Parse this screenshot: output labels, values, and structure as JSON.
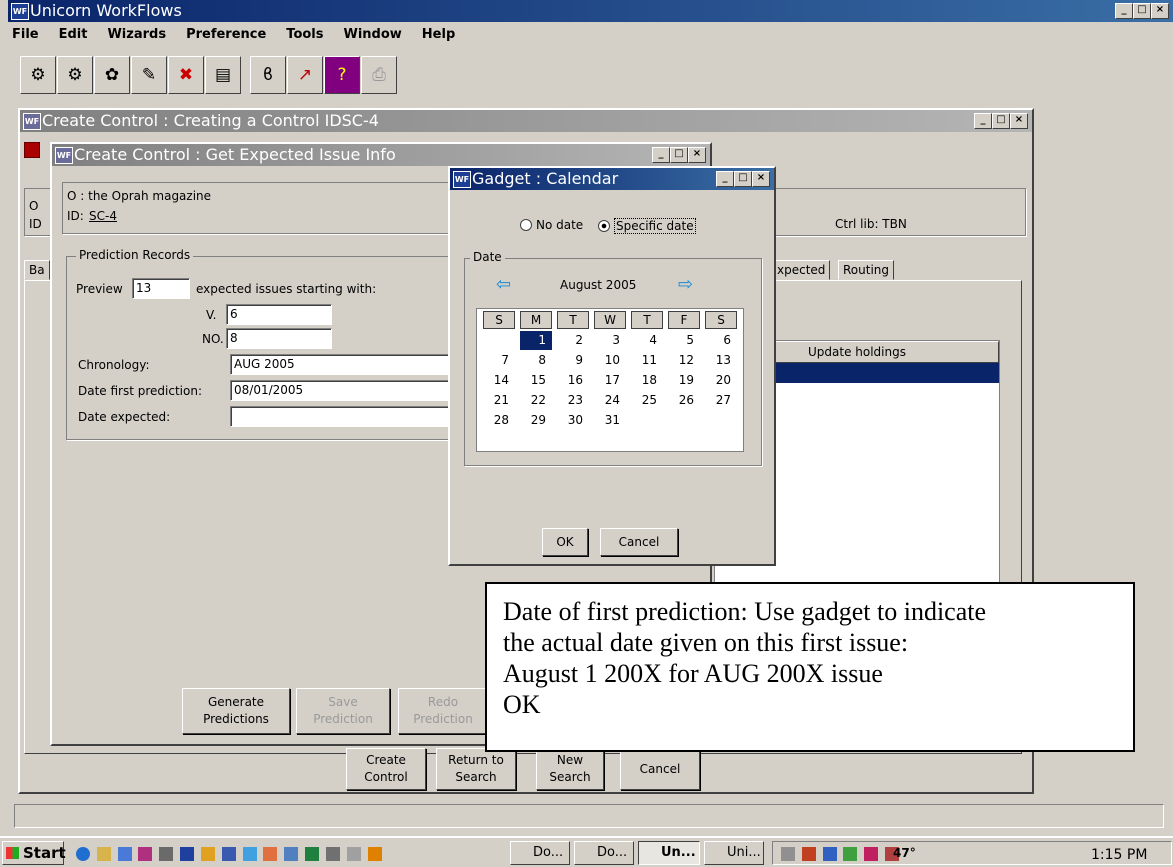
{
  "app": {
    "title": "Unicorn WorkFlows",
    "menu": [
      "File",
      "Edit",
      "Wizards",
      "Preference",
      "Tools",
      "Window",
      "Help"
    ]
  },
  "toolbar": {
    "icons": [
      "checkin-icon",
      "checkout-icon",
      "renew-icon",
      "user-icon",
      "discharge-icon",
      "display-icon",
      "holds-icon",
      "reports-icon",
      "help-icon",
      "print-icon"
    ]
  },
  "win_create_control": {
    "title": "Create Control : Creating a Control IDSC-4",
    "ctrl_lib": "Ctrl lib: TBN",
    "tabs": [
      "Ba",
      "xpected",
      "Routing"
    ],
    "column_header": "Update holdings",
    "buttons": {
      "create": "Create Control",
      "return": "Return to Search",
      "new": "New Search",
      "cancel": "Cancel"
    },
    "left_labels": [
      "O",
      "ID"
    ]
  },
  "win_expected": {
    "title": "Create Control : Get Expected Issue Info",
    "title_line": "O : the Oprah magazine",
    "id_label": "ID:",
    "id_value": "SC-4",
    "group_label": "Prediction Records",
    "preview_label": "Preview",
    "preview_value": "13",
    "preview_suffix": "expected issues starting with:",
    "v_label": "V.",
    "v_value": "6",
    "no_label": "NO.",
    "no_value": "8",
    "chronology_label": "Chronology:",
    "chronology_value": "AUG 2005",
    "first_pred_label": "Date first prediction:",
    "first_pred_value": "08/01/2005",
    "expected_label": "Date expected:",
    "expected_value": "",
    "buttons": {
      "generate": "Generate Predictions",
      "save": "Save Prediction",
      "redo": "Redo Prediction"
    }
  },
  "calendar": {
    "title": "Gadget : Calendar",
    "no_date": "No date",
    "specific_date": "Specific date",
    "selected_option": "specific",
    "group_label": "Date",
    "month": "August 2005",
    "day_headers": [
      "S",
      "M",
      "T",
      "W",
      "T",
      "F",
      "S"
    ],
    "first_weekday": 1,
    "days_in_month": 31,
    "selected_day": 1,
    "ok": "OK",
    "cancel": "Cancel"
  },
  "callout": {
    "lines": [
      "Date of first prediction: Use gadget to indicate",
      "the actual date given on this first issue:",
      "August 1 200X for AUG 200X issue",
      "OK"
    ]
  },
  "taskbar": {
    "start": "Start",
    "tasks": [
      "Do...",
      "Do...",
      "Un...",
      "Uni..."
    ],
    "active_task": 2,
    "temp": "47°",
    "clock": "1:15 PM"
  },
  "colors": {
    "title_active": "#0a246a",
    "title_inactive": "#808080",
    "face": "#d4d0c8",
    "highlight": "#0a246a"
  }
}
